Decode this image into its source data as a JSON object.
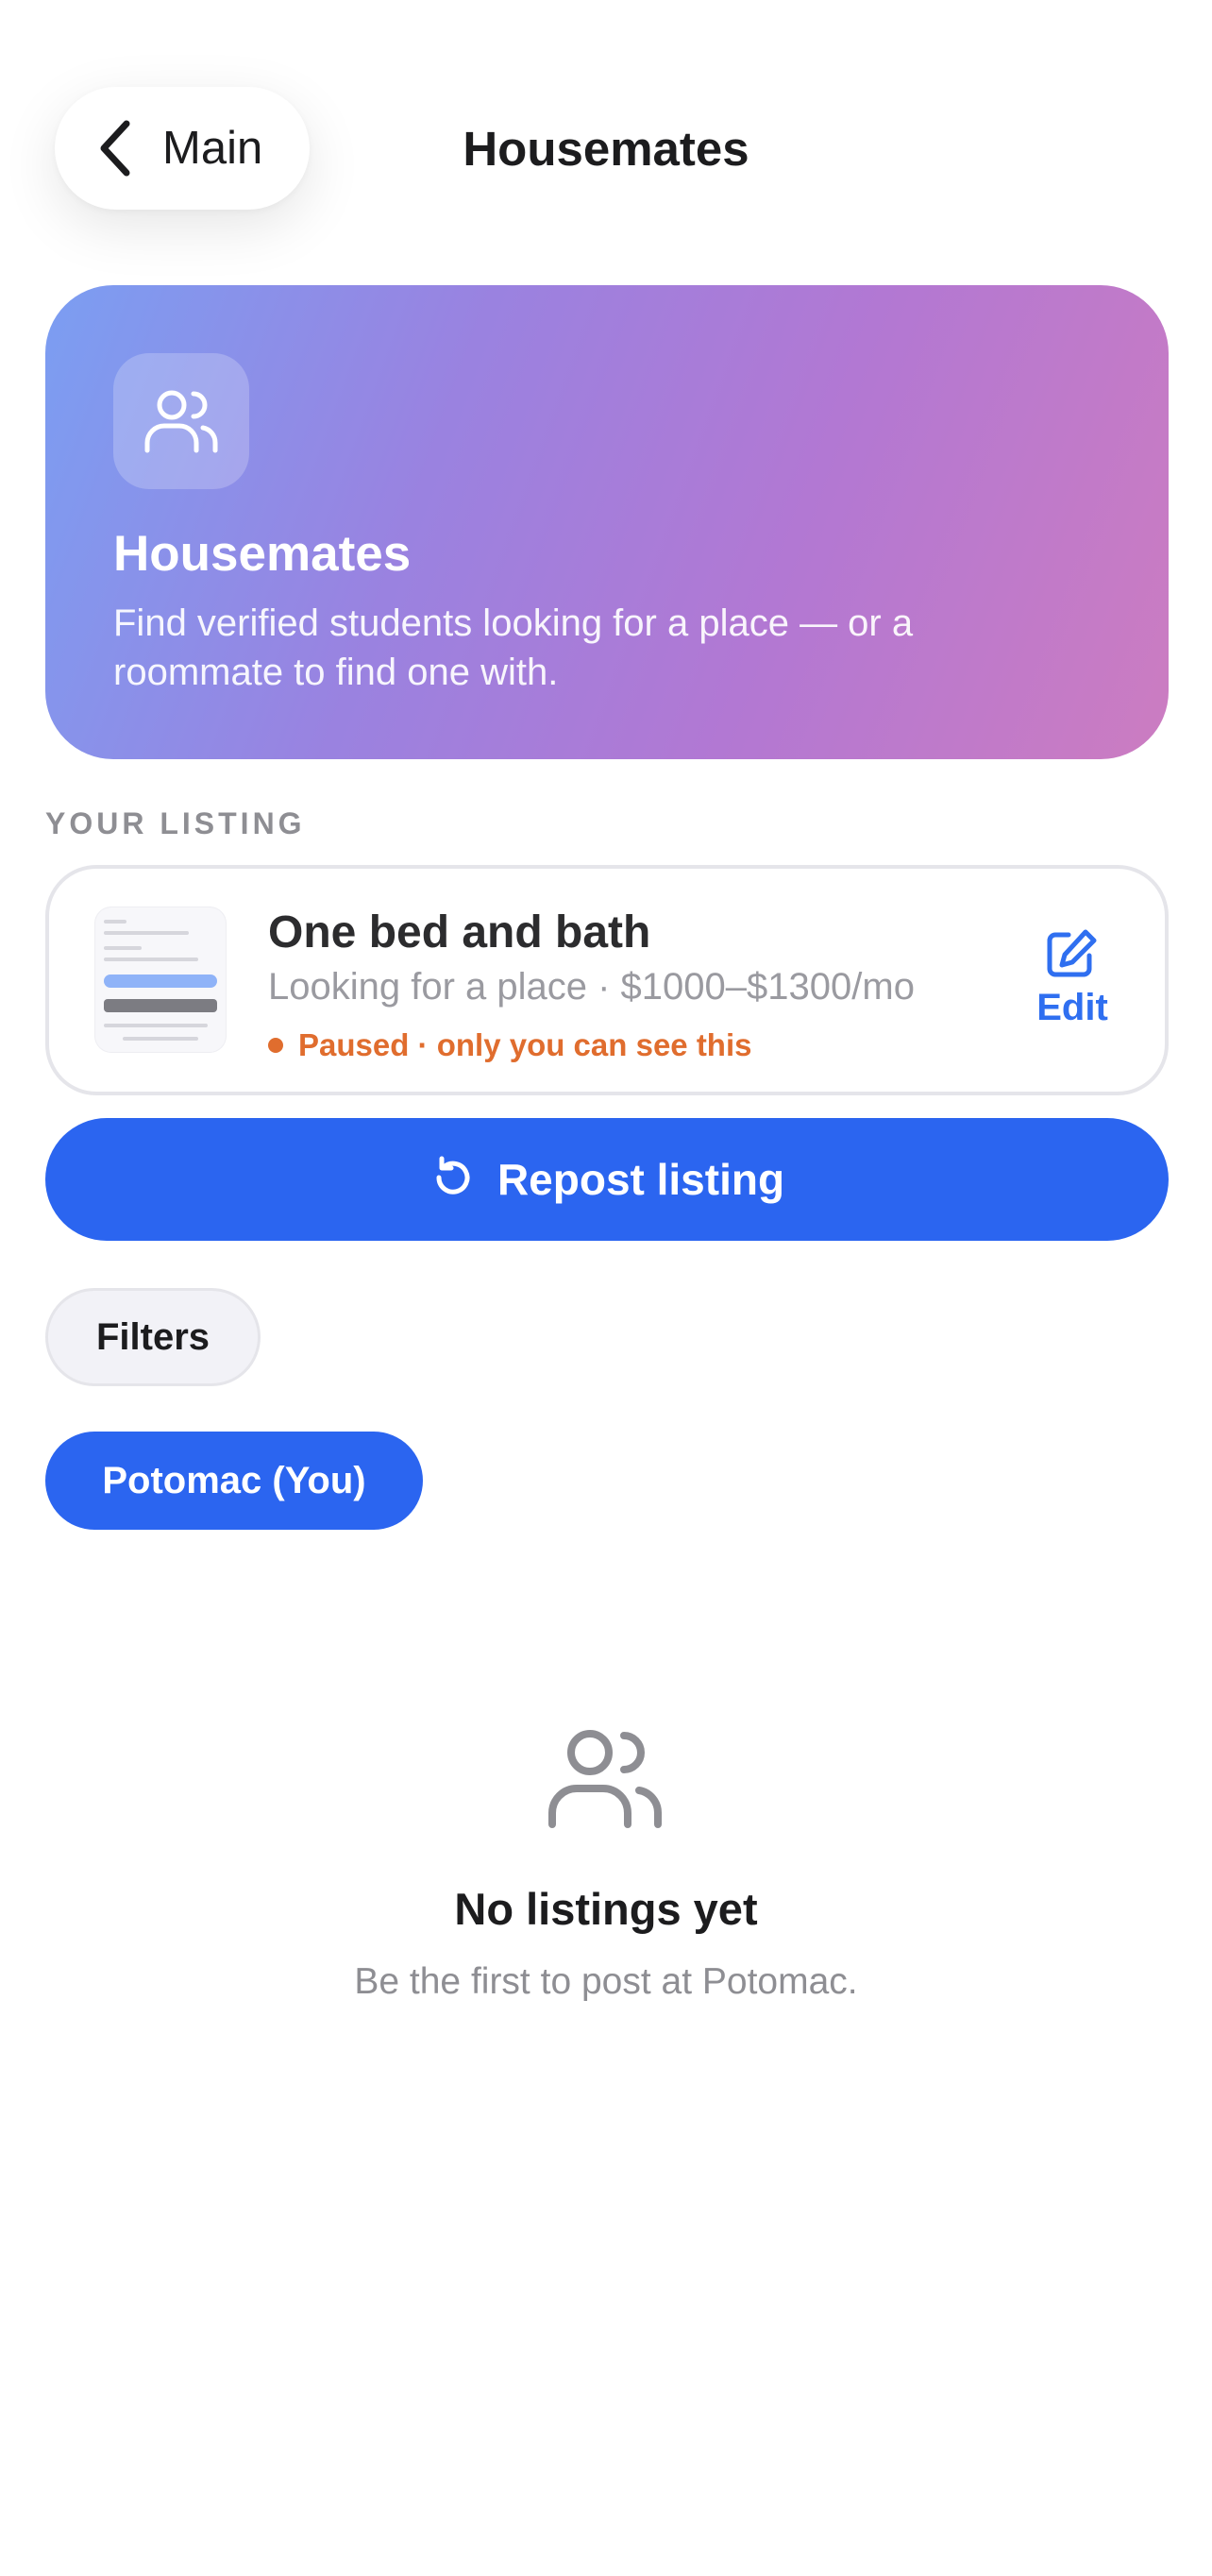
{
  "nav": {
    "back_label": "Main",
    "back_icon": "chevron-left-icon",
    "title": "Housemates"
  },
  "hero": {
    "icon": "people-icon",
    "title": "Housemates",
    "subtitle": "Find verified students looking for a place — or a roommate to find one with.",
    "gradient_start": "#7b9ef2",
    "gradient_end": "#cc7cc1"
  },
  "your_listing": {
    "section_label": "YOUR LISTING",
    "title": "One bed and bath",
    "meta": "Looking for a place · $1000–$1300/mo",
    "status": "Paused · only you can see this",
    "status_color": "#e06d2e",
    "edit_label": "Edit",
    "edit_icon": "edit-icon"
  },
  "repost": {
    "label": "Repost listing",
    "icon": "refresh-icon"
  },
  "filters": {
    "label": "Filters",
    "school_chip": "Potomac (You)"
  },
  "empty_state": {
    "icon": "people-icon",
    "title": "No listings yet",
    "subtitle": "Be the first to post at Potomac."
  },
  "colors": {
    "accent": "#2b65f0",
    "text_primary": "#1c1c1e",
    "text_secondary": "#8e8e93"
  }
}
